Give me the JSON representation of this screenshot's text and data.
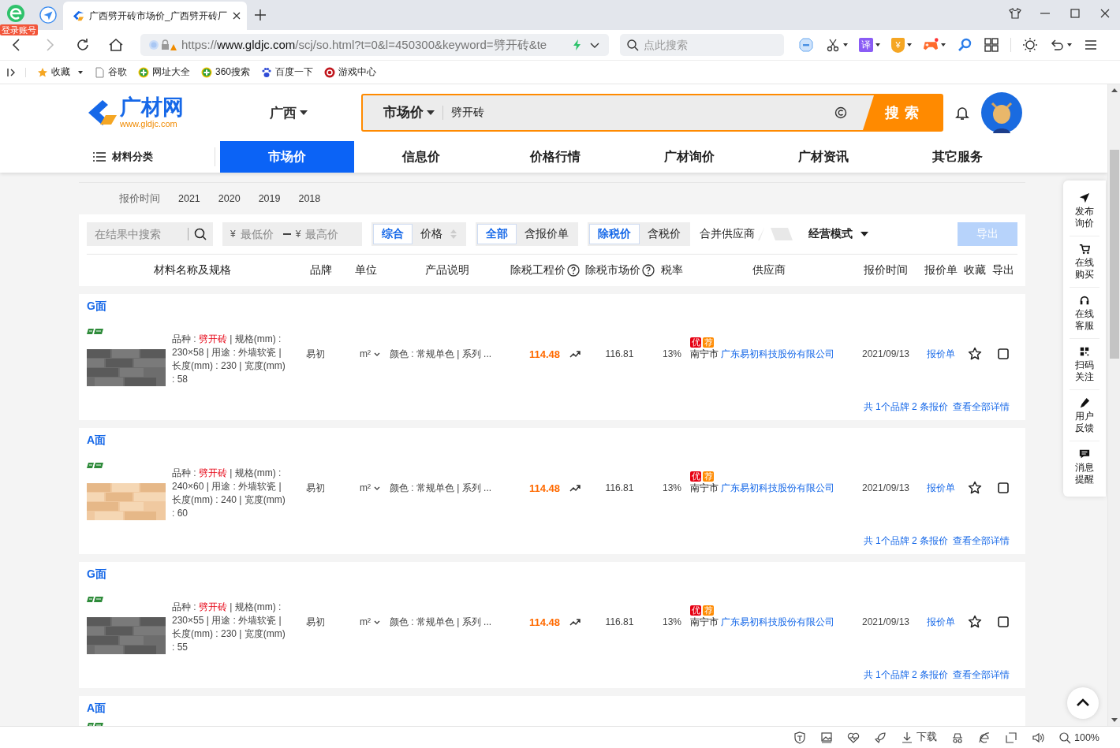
{
  "browser": {
    "login_badge": "登录账号",
    "tab": {
      "title": "广西劈开砖市场价_广西劈开砖厂"
    },
    "url": {
      "scheme": "https://",
      "domain": "www.gldjc.com",
      "path": "/scj/so.html?t=0&l=450300&keyword=劈开砖&te"
    },
    "search": {
      "placeholder": "点此搜索"
    },
    "translate_mark": "译",
    "wallet_mark": "¥",
    "bookmarks": [
      {
        "label": "收藏",
        "kind": "folder"
      },
      {
        "label": "谷歌",
        "kind": "page"
      },
      {
        "label": "网址大全",
        "kind": "plus"
      },
      {
        "label": "360搜索",
        "kind": "plus"
      },
      {
        "label": "百度一下",
        "kind": "paw"
      },
      {
        "label": "游戏中心",
        "kind": "game"
      }
    ],
    "status_bar": {
      "download": "下载",
      "zoom": "100%"
    }
  },
  "site": {
    "logo": {
      "name": "广材网",
      "domain": "www.gldjc.com"
    },
    "region": "广西",
    "search": {
      "scope": "市场价",
      "value": "劈开砖",
      "button": "搜 索"
    },
    "category_menu": "材料分类",
    "nav": [
      {
        "label": "市场价",
        "selected": true
      },
      {
        "label": "信息价",
        "selected": false
      },
      {
        "label": "价格行情",
        "selected": false
      },
      {
        "label": "广材询价",
        "selected": false
      },
      {
        "label": "广材资讯",
        "selected": false
      },
      {
        "label": "其它服务",
        "selected": false
      }
    ],
    "years": {
      "label": "报价时间",
      "items": [
        "2021",
        "2020",
        "2019",
        "2018"
      ]
    },
    "filters": {
      "search_placeholder": "在结果中搜索",
      "min_currency": "¥",
      "min_placeholder": "最低价",
      "max_currency": "¥",
      "max_placeholder": "最高价",
      "sort": [
        {
          "label": "综合",
          "selected": true
        },
        {
          "label": "价格",
          "selected": false
        }
      ],
      "scope": [
        {
          "label": "全部",
          "selected": true
        },
        {
          "label": "含报价单",
          "selected": false
        }
      ],
      "tax": [
        {
          "label": "除税价",
          "selected": true
        },
        {
          "label": "含税价",
          "selected": false
        }
      ],
      "merge": {
        "label": "合并供应商",
        "on": false
      },
      "mode": "经营模式",
      "export": {
        "label": "导出",
        "disabled": true
      }
    },
    "columns": [
      {
        "label": "材料名称及规格",
        "help": false
      },
      {
        "label": "品牌",
        "help": false
      },
      {
        "label": "单位",
        "help": false
      },
      {
        "label": "产品说明",
        "help": false
      },
      {
        "label": "除税工程价",
        "help": true
      },
      {
        "label": "除税市场价",
        "help": true
      },
      {
        "label": "税率",
        "help": false
      },
      {
        "label": "供应商",
        "help": false
      },
      {
        "label": "报价时间",
        "help": false
      },
      {
        "label": "报价单",
        "help": false
      },
      {
        "label": "收藏",
        "help": false
      },
      {
        "label": "导出",
        "help": false
      }
    ],
    "products": [
      {
        "title": "G面",
        "spec_label": "品种 : ",
        "variety": "劈开砖",
        "spec_rest": " | 规格(mm) : 230×58 | 用途 : 外墙软瓷 | 长度(mm) : 230 | 宽度(mm) : 58",
        "brand": "易初",
        "unit": "m²",
        "description": "颜色 : 常规单色 | 系列 ...",
        "price": "114.48",
        "market_price": "116.81",
        "tax": "13%",
        "badges": [
          {
            "text": "优",
            "color": "#e60012"
          },
          {
            "text": "荐",
            "color": "#ff8a00"
          }
        ],
        "city": "南宁市",
        "supplier": "广东易初科技股份有限公司",
        "date": "2021/09/13",
        "quote": "报价单",
        "favorite": false,
        "checked": false,
        "summary": "共 1个品牌 2 条报价",
        "details": "查看全部详情"
      },
      {
        "title": "A面",
        "spec_label": "品种 : ",
        "variety": "劈开砖",
        "spec_rest": " | 规格(mm) : 240×60 | 用途 : 外墙软瓷 | 长度(mm) : 240 | 宽度(mm) : 60",
        "brand": "易初",
        "unit": "m²",
        "description": "颜色 : 常规单色 | 系列 ...",
        "price": "114.48",
        "market_price": "116.81",
        "tax": "13%",
        "badges": [
          {
            "text": "优",
            "color": "#e60012"
          },
          {
            "text": "荐",
            "color": "#ff8a00"
          }
        ],
        "city": "南宁市",
        "supplier": "广东易初科技股份有限公司",
        "date": "2021/09/13",
        "quote": "报价单",
        "favorite": false,
        "checked": false,
        "summary": "共 1个品牌 2 条报价",
        "details": "查看全部详情"
      },
      {
        "title": "G面",
        "spec_label": "品种 : ",
        "variety": "劈开砖",
        "spec_rest": " | 规格(mm) : 230×55 | 用途 : 外墙软瓷 | 长度(mm) : 230 | 宽度(mm) : 55",
        "brand": "易初",
        "unit": "m²",
        "description": "颜色 : 常规单色 | 系列 ...",
        "price": "114.48",
        "market_price": "116.81",
        "tax": "13%",
        "badges": [
          {
            "text": "优",
            "color": "#e60012"
          },
          {
            "text": "荐",
            "color": "#ff8a00"
          }
        ],
        "city": "南宁市",
        "supplier": "广东易初科技股份有限公司",
        "date": "2021/09/13",
        "quote": "报价单",
        "favorite": false,
        "checked": false,
        "summary": "共 1个品牌 2 条报价",
        "details": "查看全部详情"
      }
    ],
    "partial_product": {
      "title": "A面"
    },
    "sidebar": [
      "发布询价",
      "在线购买",
      "在线客服",
      "扫码关注",
      "用户反馈",
      "消息提醒"
    ]
  }
}
